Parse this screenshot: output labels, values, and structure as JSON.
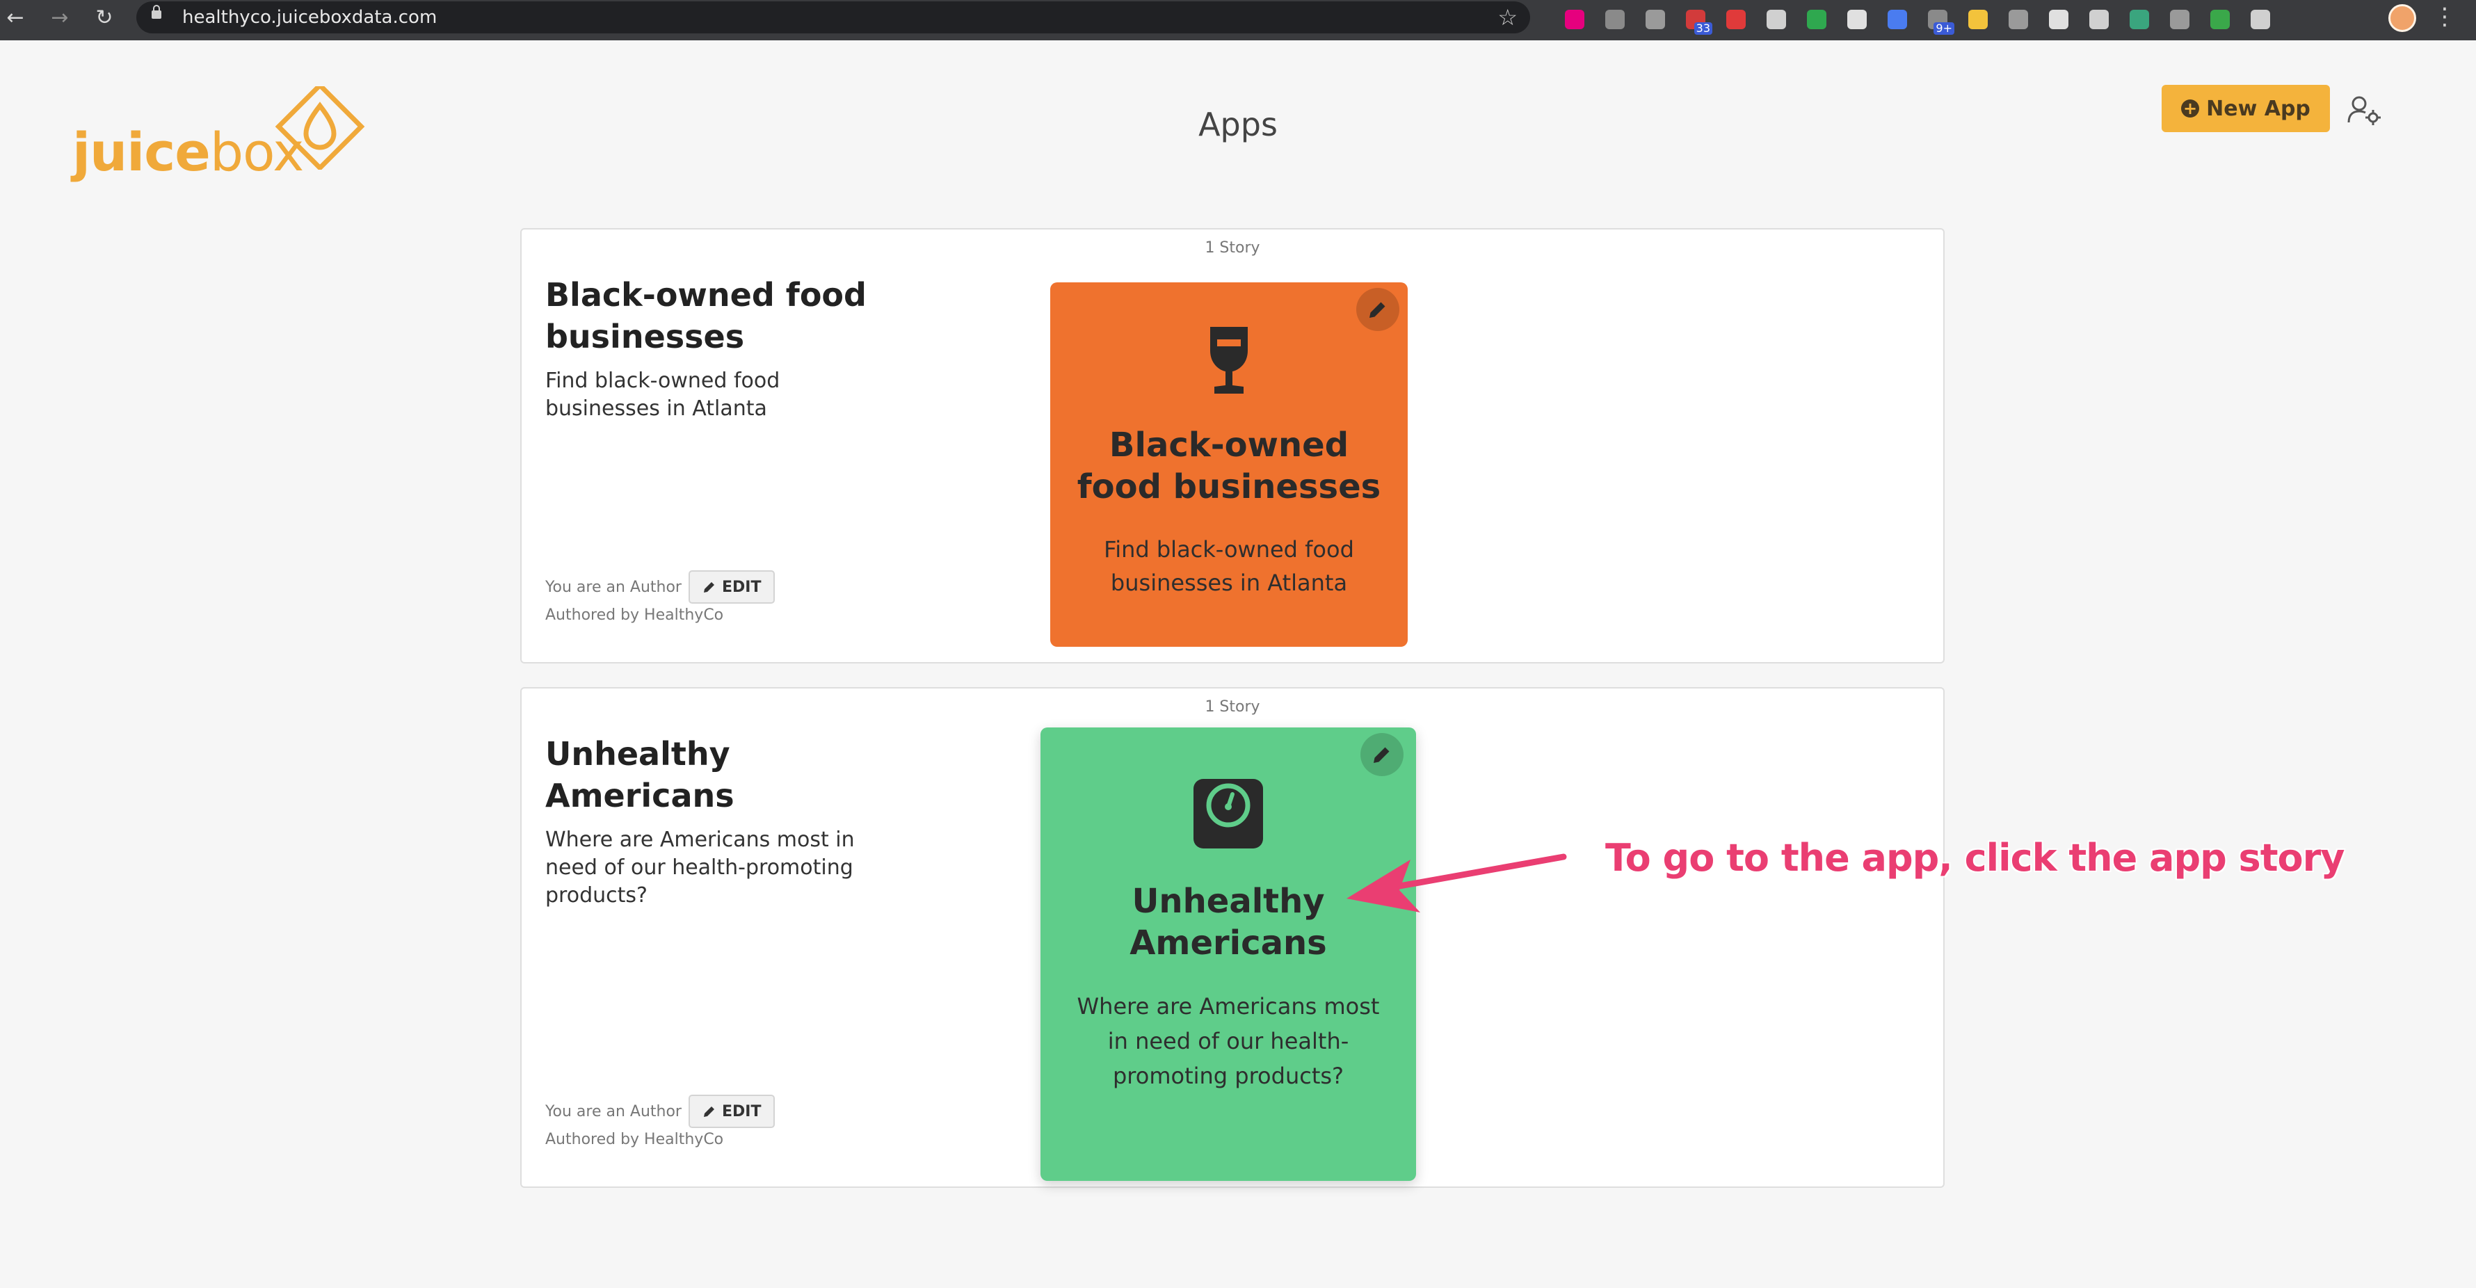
{
  "browser": {
    "url": "healthyco.juiceboxdata.com",
    "back_glyph": "←",
    "forward_glyph": "→",
    "reload_glyph": "↻",
    "star_glyph": "☆",
    "menu_glyph": "⋮",
    "extension_badges": [
      "33",
      "9+"
    ],
    "extension_colors": [
      "#e6007e",
      "#8a8a8a",
      "#9a9a9a",
      "#d23b3b",
      "#e03a3a",
      "#d0d0d0",
      "#2fa84f",
      "#e0e0e0",
      "#4a7cf0",
      "#8a8a8a",
      "#f3c33c",
      "#9a9a9a",
      "#e0e0e0",
      "#d0d0d0",
      "#3aa57e",
      "#9a9a9a",
      "#3aa84a",
      "#d0d0d0"
    ]
  },
  "header": {
    "logo_part1": "juice",
    "logo_part2": "box",
    "title": "Apps",
    "new_app_label": "New App",
    "accent_color": "#f4b33c"
  },
  "apps": [
    {
      "story_count": "1 Story",
      "name": "Black-owned food businesses",
      "description": "Find black-owned food businesses in Atlanta",
      "author_role": "You are an Author",
      "edit_label": "EDIT",
      "authored_by": "Authored by HealthyCo",
      "story": {
        "title": "Black-owned food businesses",
        "description": "Find black-owned food businesses in Atlanta",
        "icon": "wine-glass-icon",
        "color": "#ef722e"
      }
    },
    {
      "story_count": "1 Story",
      "name": "Unhealthy Americans",
      "description": "Where are Americans most in need of our health-promoting products?",
      "author_role": "You are an Author",
      "edit_label": "EDIT",
      "authored_by": "Authored by HealthyCo",
      "story": {
        "title": "Unhealthy Americans",
        "description": "Where are Americans most in need of our health-promoting products?",
        "icon": "weight-scale-icon",
        "color": "#5fcd8a"
      }
    }
  ],
  "annotation": {
    "text": "To go to the app, click the app story",
    "color": "#ea3e72"
  }
}
